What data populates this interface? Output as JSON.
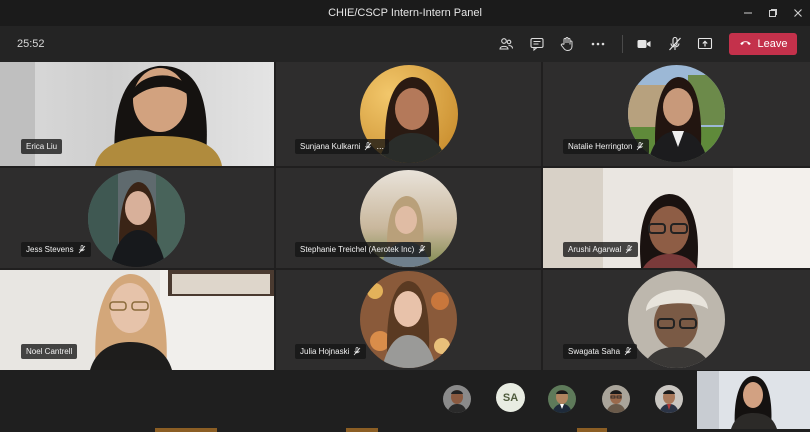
{
  "window": {
    "title": "CHIE/CSCP Intern-Intern Panel",
    "minimize_icon": "minimize-icon",
    "maximize_icon": "maximize-icon",
    "close_icon": "close-icon"
  },
  "meeting": {
    "timer": "25:52",
    "leave_label": "Leave",
    "leave_color": "#c4314b",
    "toolbar_icons": [
      "participants-icon",
      "chat-icon",
      "raise-hand-icon",
      "more-options-icon",
      "camera-icon",
      "mic-off-icon",
      "share-screen-icon",
      "phone-hangup-icon"
    ]
  },
  "participants": [
    {
      "name": "Erica Liu",
      "muted": false
    },
    {
      "name": "Sunjana Kulkarni",
      "muted": true,
      "more": "..."
    },
    {
      "name": "Natalie Herrington",
      "muted": true
    },
    {
      "name": "Jess Stevens",
      "muted": true
    },
    {
      "name": "Stephanie Treichel (Aerotek Inc)",
      "muted": true
    },
    {
      "name": "Arushi Agarwal",
      "muted": true
    },
    {
      "name": "Noel Cantrell",
      "muted": false
    },
    {
      "name": "Julia Hojnaski",
      "muted": true
    },
    {
      "name": "Swagata Saha",
      "muted": true
    }
  ],
  "strip": {
    "initials": "SA"
  }
}
